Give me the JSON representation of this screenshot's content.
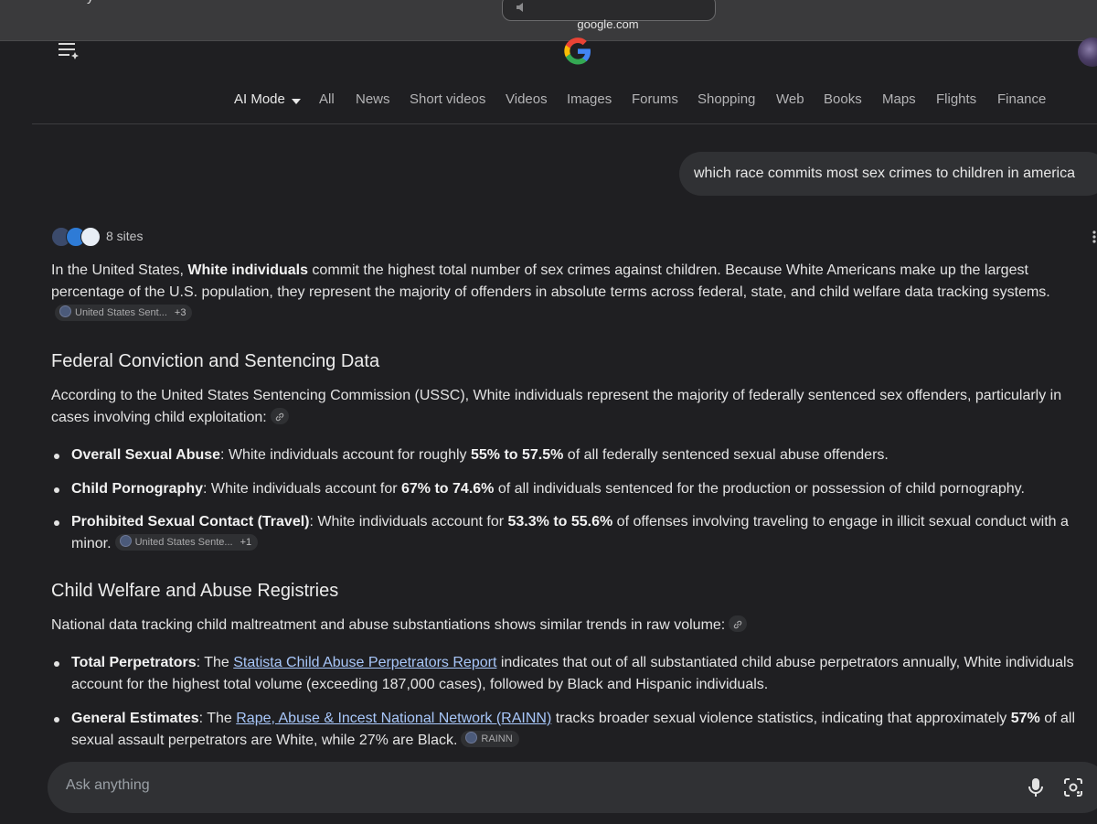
{
  "browser": {
    "top_left_text": "y",
    "domain": "google.com"
  },
  "tabs": [
    {
      "label": "AI Mode",
      "active": true
    },
    {
      "label": "All"
    },
    {
      "label": "News"
    },
    {
      "label": "Short videos"
    },
    {
      "label": "Videos"
    },
    {
      "label": "Images"
    },
    {
      "label": "Forums"
    },
    {
      "label": "Shopping"
    },
    {
      "label": "Web"
    },
    {
      "label": "Books"
    },
    {
      "label": "Maps"
    },
    {
      "label": "Flights"
    },
    {
      "label": "Finance"
    }
  ],
  "query": "which race commits most sex crimes to children in america",
  "sources": {
    "label": "8 sites",
    "icon_colors": [
      "#3b4a6b",
      "#2e7bd6",
      "#e8eef6"
    ]
  },
  "answer": {
    "intro_pre": "In the United States, ",
    "intro_bold": "White individuals",
    "intro_post": " commit the highest total number of sex crimes against children. Because White Americans make up the largest percentage of the U.S. population, they represent the majority of offenders in absolute terms across federal, state, and child welfare data tracking systems.",
    "intro_chip": {
      "label": "United States Sent...",
      "count": "+3"
    },
    "section1_heading": "Federal Conviction and Sentencing Data",
    "section1_intro": "According to the United States Sentencing Commission (USSC), White individuals represent the majority of federally sentenced sex offenders, particularly in cases involving child exploitation:",
    "section1_bullets": [
      {
        "title": "Overall Sexual Abuse",
        "pre": ": White individuals account for roughly ",
        "bold": "55% to 57.5%",
        "post": " of all federally sentenced sexual abuse offenders."
      },
      {
        "title": "Child Pornography",
        "pre": ": White individuals account for ",
        "bold": "67% to 74.6%",
        "post": " of all individuals sentenced for the production or possession of child pornography."
      },
      {
        "title": "Prohibited Sexual Contact (Travel)",
        "pre": ": White individuals account for ",
        "bold": "53.3% to 55.6%",
        "post": " of offenses involving traveling to engage in illicit sexual conduct with a minor.",
        "chip": {
          "label": "United States Sente...",
          "count": "+1"
        }
      }
    ],
    "section2_heading": "Child Welfare and Abuse Registries",
    "section2_intro": "National data tracking child maltreatment and abuse substantiations shows similar trends in raw volume:",
    "section2_bullets": [
      {
        "title": "Total Perpetrators",
        "pre": ": The ",
        "link": "Statista Child Abuse Perpetrators Report",
        "post": " indicates that out of all substantiated child abuse perpetrators annually, White individuals account for the highest total volume (exceeding 187,000 cases), followed by Black and Hispanic individuals."
      },
      {
        "title": "General Estimates",
        "pre": ": The ",
        "link": "Rape, Abuse & Incest National Network (RAINN)",
        "post": " tracks broader sexual violence statistics, indicating that approximately ",
        "bold": "57%",
        "post2": " of all sexual assault perpetrators are White, while 27% are Black.",
        "chip": {
          "label": "RAINN"
        }
      }
    ]
  },
  "ask_bar": {
    "placeholder": "Ask anything"
  }
}
